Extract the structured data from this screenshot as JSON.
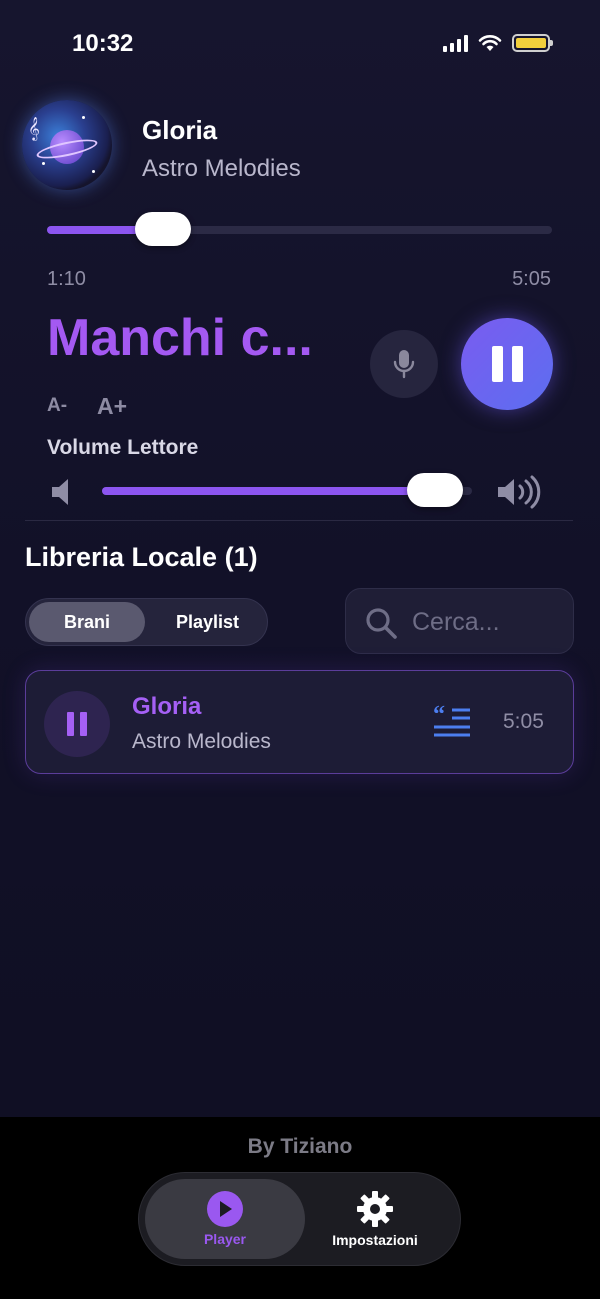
{
  "status_bar": {
    "time": "10:32"
  },
  "now_playing": {
    "title": "Gloria",
    "artist": "Astro Melodies",
    "elapsed": "1:10",
    "duration": "5:05",
    "progress_fraction": 0.23,
    "current_lyric": "Manchi c..."
  },
  "font_controls": {
    "decrease": "A-",
    "increase": "A+"
  },
  "volume": {
    "label": "Volume Lettore",
    "level_fraction": 0.9
  },
  "library": {
    "title": "Libreria Locale (1)",
    "tabs": [
      {
        "label": "Brani",
        "selected": true
      },
      {
        "label": "Playlist",
        "selected": false
      }
    ],
    "search": {
      "placeholder": "Cerca..."
    },
    "tracks": [
      {
        "title": "Gloria",
        "artist": "Astro Melodies",
        "duration": "5:05"
      }
    ]
  },
  "footer": {
    "credit": "By Tiziano",
    "tabs": [
      {
        "label": "Player",
        "icon": "play-circle-icon",
        "active": true
      },
      {
        "label": "Impostazioni",
        "icon": "gear-icon",
        "active": false
      }
    ]
  },
  "colors": {
    "accent": "#a459f2",
    "background": "#12112a",
    "battery": "#f2cf3c"
  }
}
